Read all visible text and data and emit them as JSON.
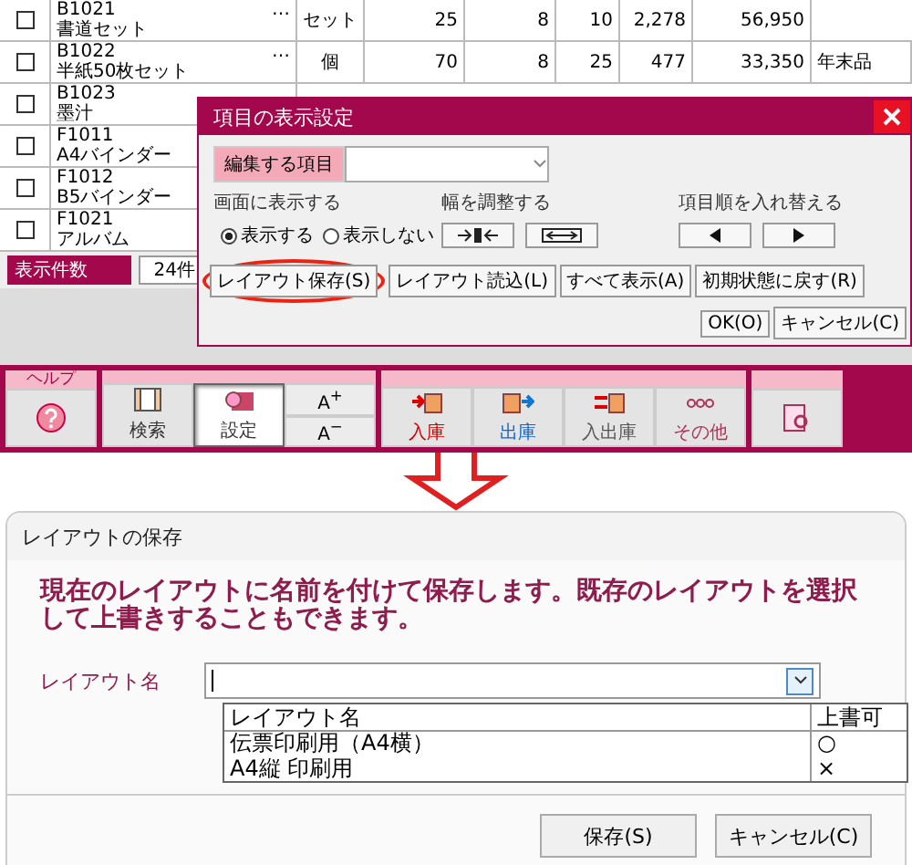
{
  "table": {
    "rows": [
      {
        "checked": false,
        "code": "B1021",
        "name": "書道セット",
        "more": "…",
        "cells": [
          "セット",
          "25",
          "8",
          "10",
          "2,278",
          "56,950"
        ]
      },
      {
        "checked": false,
        "code": "B1022",
        "name": "半紙50枚セット",
        "more": "…",
        "cells": [
          "個",
          "70",
          "8",
          "25",
          "477",
          "33,350",
          "年末品"
        ]
      },
      {
        "checked": false,
        "code": "B1023",
        "name": "墨汁"
      },
      {
        "checked": false,
        "code": "F1011",
        "name": "A4バインダー"
      },
      {
        "checked": false,
        "code": "F1012",
        "name": "B5バインダー"
      },
      {
        "checked": false,
        "code": "F1021",
        "name": "アルバム"
      }
    ]
  },
  "status_bar": {
    "label": "表示件数",
    "value": "24件"
  },
  "toolbar": {
    "groups": [
      {
        "title": "ヘルプ",
        "items": [
          {
            "kind": "help",
            "selected": false
          }
        ]
      },
      {
        "items": [
          {
            "kind": "search",
            "label": "検索",
            "selected": false
          },
          {
            "kind": "settings",
            "label": "設定",
            "selected": true
          },
          {
            "kind": "font",
            "labels": [
              "A$^{+}$",
              "A$^{−}$"
            ]
          }
        ]
      },
      {
        "items": [
          {
            "kind": "stock_in",
            "label": "入庫",
            "selected": false
          },
          {
            "kind": "stock_out",
            "label": "出庫",
            "selected": false
          },
          {
            "kind": "transfer",
            "label": "入出庫",
            "selected": false
          },
          {
            "kind": "more",
            "label": "その他",
            "selected": false
          }
        ]
      },
      {
        "items": [
          {
            "kind": "report",
            "selected": false
          }
        ]
      }
    ]
  },
  "display_dialog": {
    "title": "項目の表示設定",
    "field_label": "編集する項目",
    "show_label": "画面に表示する",
    "radios": [
      {
        "label": "表示する",
        "selected": true
      },
      {
        "label": "表示しない",
        "selected": false
      }
    ],
    "width_label": "幅を調整する",
    "order_label": "項目順を入れ替える",
    "buttons": [
      {
        "label": "レイアウト保存(S)",
        "circled": true
      },
      {
        "label": "レイアウト読込(L)",
        "circled": false
      },
      {
        "label": "すべて表示(A)",
        "circled": false
      },
      {
        "label": "初期状態に戻す(R)",
        "circled": false
      },
      {
        "label": "OK(O)",
        "circled": false
      },
      {
        "label": "キャンセル(C)",
        "circled": false
      }
    ]
  },
  "save_dialog": {
    "title": "レイアウトの保存",
    "message": "現在のレイアウトに名前を付けて保存します。既存のレイアウトを選択して上書きすることもできます。",
    "field_label": "レイアウト名",
    "list": {
      "columns": [
        "レイアウト名",
        "上書可"
      ],
      "rows": [
        [
          "伝票印刷用（A4横）",
          "○"
        ],
        [
          "A4縦 印刷用",
          "×"
        ]
      ]
    },
    "buttons": [
      "保存(S)",
      "キャンセル(C)"
    ]
  }
}
